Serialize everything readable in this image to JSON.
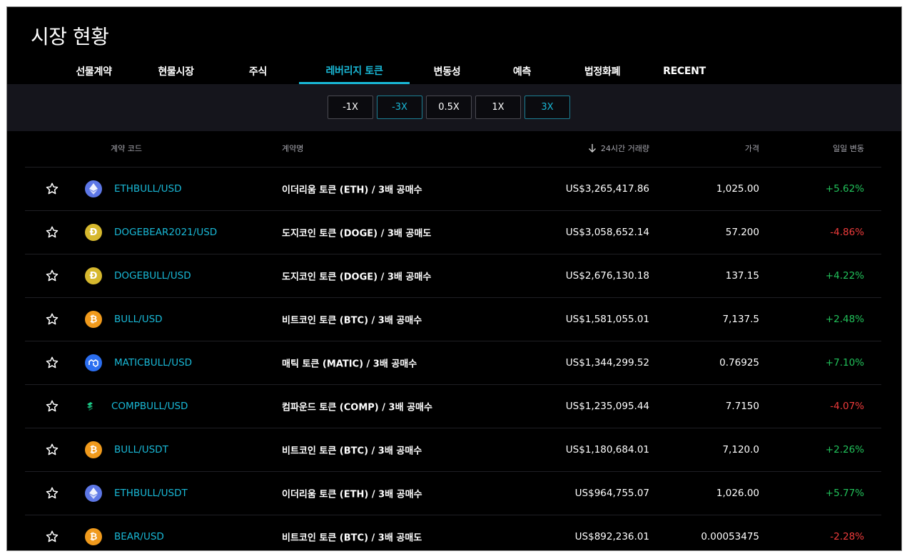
{
  "page_title": "시장 현황",
  "tabs": [
    {
      "label": "선물계약",
      "active": false
    },
    {
      "label": "현물시장",
      "active": false
    },
    {
      "label": "주식",
      "active": false
    },
    {
      "label": "레버리지 토큰",
      "active": true
    },
    {
      "label": "변동성",
      "active": false
    },
    {
      "label": "예측",
      "active": false
    },
    {
      "label": "법정화폐",
      "active": false
    },
    {
      "label": "RECENT",
      "active": false
    }
  ],
  "filters": [
    {
      "label": "-1X",
      "selected": false
    },
    {
      "label": "-3X",
      "selected": true
    },
    {
      "label": "0.5X",
      "selected": false
    },
    {
      "label": "1X",
      "selected": false
    },
    {
      "label": "3X",
      "selected": true
    }
  ],
  "table": {
    "headers": {
      "code": "계약 코드",
      "name": "계약명",
      "volume": "24시간 거래량",
      "price": "가격",
      "change": "일일 변동"
    },
    "sort_icon": "arrow-down-icon",
    "rows": [
      {
        "icon": "eth",
        "code": "ETHBULL/USD",
        "name": "이더리움 토큰 (ETH) / 3배 공매수",
        "volume": "US$3,265,417.86",
        "price": "1,025.00",
        "change": "+5.62%",
        "direction": "pos"
      },
      {
        "icon": "doge",
        "code": "DOGEBEAR2021/USD",
        "name": "도지코인 토큰 (DOGE) / 3배 공매도",
        "volume": "US$3,058,652.14",
        "price": "57.200",
        "change": "-4.86%",
        "direction": "neg"
      },
      {
        "icon": "doge",
        "code": "DOGEBULL/USD",
        "name": "도지코인 토큰 (DOGE) / 3배 공매수",
        "volume": "US$2,676,130.18",
        "price": "137.15",
        "change": "+4.22%",
        "direction": "pos"
      },
      {
        "icon": "btc",
        "code": "BULL/USD",
        "name": "비트코인 토큰 (BTC) / 3배 공매수",
        "volume": "US$1,581,055.01",
        "price": "7,137.5",
        "change": "+2.48%",
        "direction": "pos"
      },
      {
        "icon": "matic",
        "code": "MATICBULL/USD",
        "name": "매틱 토큰 (MATIC) / 3배 공매수",
        "volume": "US$1,344,299.52",
        "price": "0.76925",
        "change": "+7.10%",
        "direction": "pos"
      },
      {
        "icon": "comp",
        "code": "COMPBULL/USD",
        "name": "컴파운드 토큰 (COMP) / 3배 공매수",
        "volume": "US$1,235,095.44",
        "price": "7.7150",
        "change": "-4.07%",
        "direction": "neg"
      },
      {
        "icon": "btc",
        "code": "BULL/USDT",
        "name": "비트코인 토큰 (BTC) / 3배 공매수",
        "volume": "US$1,180,684.01",
        "price": "7,120.0",
        "change": "+2.26%",
        "direction": "pos"
      },
      {
        "icon": "eth",
        "code": "ETHBULL/USDT",
        "name": "이더리움 토큰 (ETH) / 3배 공매수",
        "volume": "US$964,755.07",
        "price": "1,026.00",
        "change": "+5.77%",
        "direction": "pos"
      },
      {
        "icon": "btc",
        "code": "BEAR/USD",
        "name": "비트코인 토큰 (BTC) / 3배 공매도",
        "volume": "US$892,236.01",
        "price": "0.00053475",
        "change": "-2.28%",
        "direction": "neg"
      }
    ]
  },
  "colors": {
    "accent": "#19b8d6",
    "positive": "#21c15a",
    "negative": "#ee3b3b",
    "background": "#000000",
    "filter_bar": "#15151c"
  }
}
